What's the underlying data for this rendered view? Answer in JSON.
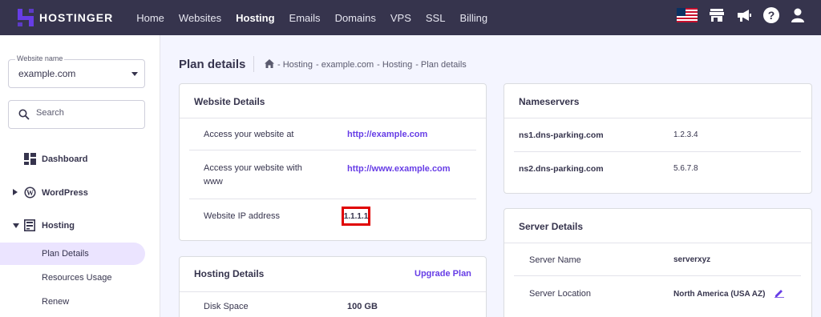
{
  "brand": {
    "name": "HOSTINGER",
    "accent": "#673de6"
  },
  "topnav": {
    "links": [
      "Home",
      "Websites",
      "Hosting",
      "Emails",
      "Domains",
      "VPS",
      "SSL",
      "Billing"
    ],
    "active": "Hosting",
    "icons": [
      "us-flag-icon",
      "store-icon",
      "megaphone-icon",
      "help-icon",
      "user-icon"
    ]
  },
  "sidebar": {
    "website_select": {
      "label": "Website name",
      "value": "example.com"
    },
    "search": {
      "placeholder": "Search"
    },
    "items": [
      {
        "label": "Dashboard",
        "icon": "dashboard-icon"
      },
      {
        "label": "WordPress",
        "icon": "wordpress-icon"
      },
      {
        "label": "Hosting",
        "icon": "hosting-icon"
      }
    ],
    "sub_items": [
      "Plan Details",
      "Resources Usage",
      "Renew"
    ],
    "active_sub": "Plan Details"
  },
  "page": {
    "title": "Plan details",
    "breadcrumb": [
      "- Hosting",
      "- example.com",
      "- Hosting",
      "- Plan details"
    ]
  },
  "website_details": {
    "title": "Website Details",
    "rows": [
      {
        "label": "Access your website at",
        "value": "http://example.com"
      },
      {
        "label": "Access your website with www",
        "value": "http://www.example.com"
      },
      {
        "label": "Website IP address",
        "value": "1.1.1.1"
      }
    ]
  },
  "hosting_details": {
    "title": "Hosting Details",
    "upgrade_label": "Upgrade Plan",
    "rows": [
      {
        "label": "Disk Space",
        "value": "100 GB"
      }
    ]
  },
  "nameservers": {
    "title": "Nameservers",
    "rows": [
      {
        "name": "ns1.dns-parking.com",
        "ip": "1.2.3.4"
      },
      {
        "name": "ns2.dns-parking.com",
        "ip": "5.6.7.8"
      }
    ]
  },
  "server_details": {
    "title": "Server Details",
    "rows": [
      {
        "label": "Server Name",
        "value": "serverxyz"
      },
      {
        "label": "Server Location",
        "value": "North America (USA AZ)"
      }
    ]
  }
}
